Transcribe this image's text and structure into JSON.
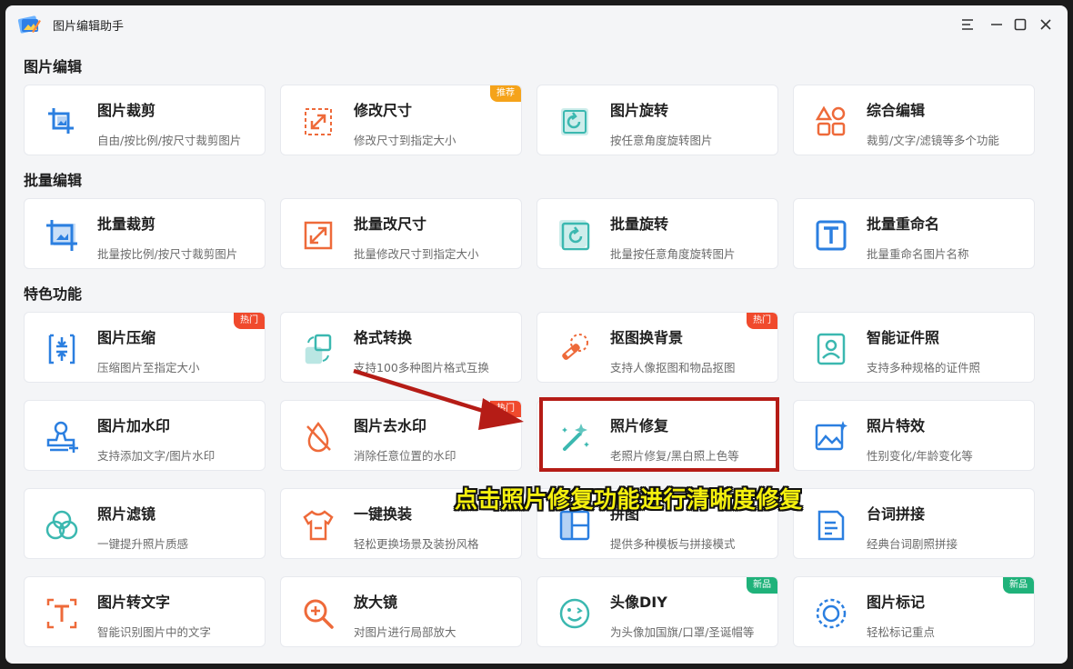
{
  "app": {
    "title": "图片编辑助手"
  },
  "sections": [
    {
      "title": "图片编辑",
      "cards": [
        {
          "title": "图片裁剪",
          "desc": "自由/按比例/按尺寸裁剪图片",
          "badge": ""
        },
        {
          "title": "修改尺寸",
          "desc": "修改尺寸到指定大小",
          "badge": "推荐"
        },
        {
          "title": "图片旋转",
          "desc": "按任意角度旋转图片",
          "badge": ""
        },
        {
          "title": "综合编辑",
          "desc": "裁剪/文字/滤镜等多个功能",
          "badge": ""
        }
      ]
    },
    {
      "title": "批量编辑",
      "cards": [
        {
          "title": "批量裁剪",
          "desc": "批量按比例/按尺寸裁剪图片",
          "badge": ""
        },
        {
          "title": "批量改尺寸",
          "desc": "批量修改尺寸到指定大小",
          "badge": ""
        },
        {
          "title": "批量旋转",
          "desc": "批量按任意角度旋转图片",
          "badge": ""
        },
        {
          "title": "批量重命名",
          "desc": "批量重命名图片名称",
          "badge": ""
        }
      ]
    },
    {
      "title": "特色功能",
      "cards": [
        {
          "title": "图片压缩",
          "desc": "压缩图片至指定大小",
          "badge": "热门"
        },
        {
          "title": "格式转换",
          "desc": "支持100多种图片格式互换",
          "badge": ""
        },
        {
          "title": "抠图换背景",
          "desc": "支持人像抠图和物品抠图",
          "badge": "热门"
        },
        {
          "title": "智能证件照",
          "desc": "支持多种规格的证件照",
          "badge": ""
        },
        {
          "title": "图片加水印",
          "desc": "支持添加文字/图片水印",
          "badge": ""
        },
        {
          "title": "图片去水印",
          "desc": "消除任意位置的水印",
          "badge": "热门"
        },
        {
          "title": "照片修复",
          "desc": "老照片修复/黑白照上色等",
          "badge": ""
        },
        {
          "title": "照片特效",
          "desc": "性别变化/年龄变化等",
          "badge": ""
        },
        {
          "title": "照片滤镜",
          "desc": "一键提升照片质感",
          "badge": ""
        },
        {
          "title": "一键换装",
          "desc": "轻松更换场景及装扮风格",
          "badge": ""
        },
        {
          "title": "拼图",
          "desc": "提供多种模板与拼接模式",
          "badge": ""
        },
        {
          "title": "台词拼接",
          "desc": "经典台词剧照拼接",
          "badge": ""
        },
        {
          "title": "图片转文字",
          "desc": "智能识别图片中的文字",
          "badge": ""
        },
        {
          "title": "放大镜",
          "desc": "对图片进行局部放大",
          "badge": ""
        },
        {
          "title": "头像DIY",
          "desc": "为头像加国旗/口罩/圣诞帽等",
          "badge": "新品"
        },
        {
          "title": "图片标记",
          "desc": "轻松标记重点",
          "badge": "新品"
        }
      ]
    }
  ],
  "icons": [
    "crop-icon",
    "resize-icon",
    "rotate-icon",
    "shapes-icon",
    "batch-crop-icon",
    "batch-resize-icon",
    "batch-rotate-icon",
    "rename-icon",
    "compress-icon",
    "convert-icon",
    "cutout-icon",
    "id-photo-icon",
    "watermark-icon",
    "remove-watermark-icon",
    "magic-wand-icon",
    "photo-effect-icon",
    "filter-icon",
    "outfit-icon",
    "collage-icon",
    "caption-join-icon",
    "ocr-icon",
    "magnifier-icon",
    "avatar-icon",
    "marker-icon"
  ],
  "colors": {
    "accent_blue": "#2b7fe0",
    "accent_orange": "#ee6a3a",
    "accent_teal": "#3bb8b0",
    "badge_orange": "#f5a31a",
    "badge_red": "#f04a2d",
    "badge_green": "#1fb27a",
    "highlight_red": "#b51c16",
    "caption_yellow": "#f5f00e"
  },
  "annotation": {
    "caption": "点击照片修复功能进行清晰度修复"
  }
}
